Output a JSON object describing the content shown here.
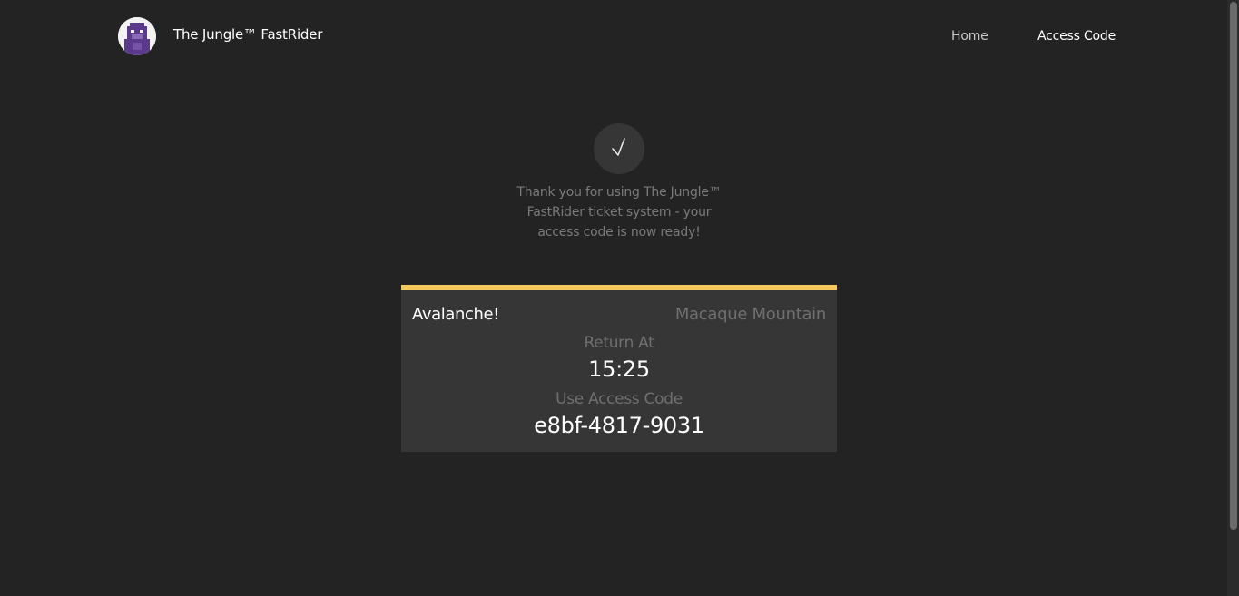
{
  "header": {
    "brand": "The Jungle™ FastRider",
    "logo_icon": "gorilla-logo-icon",
    "nav": {
      "home": "Home",
      "access_code": "Access Code"
    }
  },
  "confirmation": {
    "icon": "checkmark-icon",
    "check_glyph": "√",
    "message": "Thank you for using The Jungle™ FastRider ticket system - your access code is now ready!"
  },
  "ticket": {
    "accent_color": "#f5c95e",
    "ride_name": "Avalanche!",
    "zone_name": "Macaque Mountain",
    "return_label": "Return At",
    "return_time": "15:25",
    "code_label": "Use Access Code",
    "access_code": "e8bf-4817-9031"
  },
  "colors": {
    "background": "#232323",
    "card": "#363636",
    "logo_purple": "#5b3a8c"
  }
}
